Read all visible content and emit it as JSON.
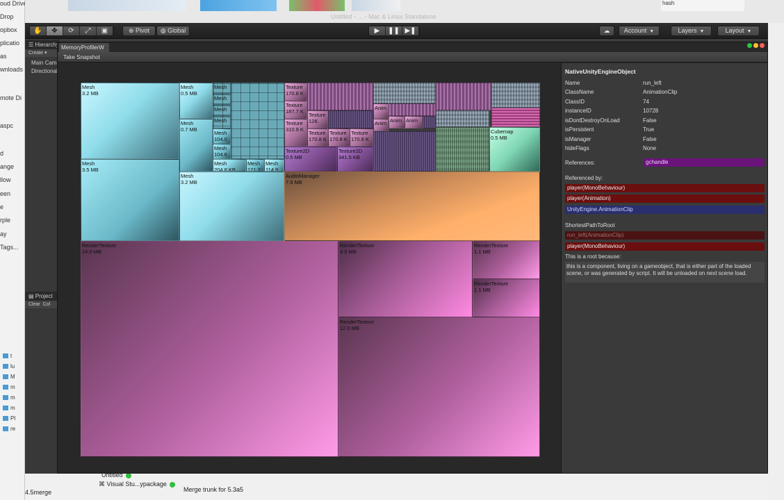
{
  "desktop": {
    "left_items": [
      "oud Drive",
      "Drop",
      "opbox",
      "plicatio",
      "as",
      "wnloads",
      "mote Di",
      "aspc",
      "d",
      "ange",
      "llow",
      "een",
      "e",
      "rple",
      "ay",
      "Tags..."
    ],
    "left_bottom_items": [
      "t",
      "lu",
      "M",
      "m",
      "m",
      "m",
      "Pl",
      "re"
    ],
    "top_hint": "Untitled - ... - Mac & Linux Standalone",
    "bottom_rows": [
      "Untitled",
      "Visual Stu...ypackage",
      "4.5merge",
      "Merge trunk for 5.3a5"
    ],
    "right_labels": [
      "hash"
    ]
  },
  "unity": {
    "toolbar": {
      "tools": [
        "✋",
        "✥",
        "⟳",
        "⤢",
        "▣"
      ],
      "pivot_label": "Pivot",
      "global_label": "Global",
      "play_controls": [
        "▶",
        "❚❚",
        "▶❚"
      ],
      "cloud_icon": "☁",
      "account_label": "Account",
      "layers_label": "Layers",
      "layout_label": "Layout"
    },
    "hierarchy": {
      "tab_label": "Hierarchy",
      "create_label": "Create ▾",
      "items": [
        "Main Camera",
        "Directional Light"
      ]
    },
    "project": {
      "tab_label": "Project",
      "clear_label": "Clear",
      "collapse_label": "Col"
    },
    "memory_profiler": {
      "tab_label": "MemoryProfilerW",
      "take_snapshot_label": "Take Snapshot",
      "treemap": [
        {
          "name": "Mesh",
          "size": "3.2 MB",
          "cls": "cyan"
        },
        {
          "name": "Mesh",
          "size": "3.5 MB",
          "cls": "cyan2"
        },
        {
          "name": "Mesh",
          "size": "0.5 MB",
          "cls": "cyan"
        },
        {
          "name": "Mesh",
          "size": "0.7 MB",
          "cls": "cyan2"
        },
        {
          "name": "Mesh",
          "size": "3.2 MB",
          "cls": "cyan"
        },
        {
          "name": "Mesh",
          "size": "",
          "cls": "small-grid"
        },
        {
          "name": "Mesh",
          "size": "",
          "cls": "small-grid"
        },
        {
          "name": "Mesh",
          "size": "",
          "cls": "small-grid"
        },
        {
          "name": "Mesh",
          "size": "",
          "cls": "small-grid"
        },
        {
          "name": "Mesh",
          "size": "104.0",
          "cls": "cyan2"
        },
        {
          "name": "Mesh",
          "size": "104.6",
          "cls": "cyan2"
        },
        {
          "name": "Mesh",
          "size": "204.8 KB",
          "cls": "cyan"
        },
        {
          "name": "Mesh",
          "size": "121.2",
          "cls": "cyan2"
        },
        {
          "name": "Mesh",
          "size": "114.9",
          "cls": "cyan"
        },
        {
          "name": "Texture",
          "size": "170.8 K",
          "cls": "mauve"
        },
        {
          "name": "Texture",
          "size": "187.7 K",
          "cls": "mauve"
        },
        {
          "name": "Texture",
          "size": "310.9 K",
          "cls": "mauve"
        },
        {
          "name": "Texture2D",
          "size": "0.5 MB",
          "cls": "purple"
        },
        {
          "name": "Texture2D",
          "size": "341.5 KB",
          "cls": "purple"
        },
        {
          "name": "Texture",
          "size": "170.8 K",
          "cls": "mauve"
        },
        {
          "name": "Texture",
          "size": "170.8 K",
          "cls": "mauve"
        },
        {
          "name": "Texture",
          "size": "170.8 K",
          "cls": "mauve"
        },
        {
          "name": "Texture",
          "size": "128.",
          "cls": "mauve"
        },
        {
          "name": "Anim",
          "size": "",
          "cls": "mauve"
        },
        {
          "name": "Anim",
          "size": "",
          "cls": "mauve"
        },
        {
          "name": "Anim",
          "size": "",
          "cls": "mauve"
        },
        {
          "name": "Anim",
          "size": "",
          "cls": "mauve"
        },
        {
          "name": "Cubemap",
          "size": "0.5 MB",
          "cls": "greenish"
        },
        {
          "name": "AudioManager",
          "size": "7.9 MB",
          "cls": "orange"
        },
        {
          "name": "RenderTexture",
          "size": "24.0 MB",
          "cls": "pink"
        },
        {
          "name": "RenderTexture",
          "size": "4.5 MB",
          "cls": "pink2"
        },
        {
          "name": "RenderTexture",
          "size": "1.1 MB",
          "cls": "pink"
        },
        {
          "name": "RenderTexture",
          "size": "1.1 MB",
          "cls": "pink2"
        },
        {
          "name": "RenderTexture",
          "size": "12.0 MB",
          "cls": "pink"
        }
      ],
      "inspector": {
        "title": "NativeUnityEngineObject",
        "properties": [
          {
            "key": "Name",
            "value": "run_left"
          },
          {
            "key": "ClassName",
            "value": "AnimationClip"
          },
          {
            "key": "ClassID",
            "value": "74"
          },
          {
            "key": "instanceID",
            "value": "10728"
          },
          {
            "key": "isDontDestroyOnLoad",
            "value": "False"
          },
          {
            "key": "isPersistent",
            "value": "True"
          },
          {
            "key": "isManager",
            "value": "False"
          },
          {
            "key": "hideFlags",
            "value": "None"
          }
        ],
        "references_label": "References:",
        "references": [
          "gchandle"
        ],
        "referenced_by_label": "Referenced by:",
        "referenced_by": [
          {
            "label": "player(MonoBehaviour)",
            "kind": "red"
          },
          {
            "label": "player(Animation)",
            "kind": "red"
          },
          {
            "label": "UnityEngine.AnimationClip",
            "kind": "blue"
          }
        ],
        "shortest_path_label": "ShortestPathToRoot",
        "shortest_path": [
          {
            "label": "run_left(AnimationClip)",
            "kind": "red dim"
          },
          {
            "label": "player(MonoBehaviour)",
            "kind": "red"
          }
        ],
        "root_reason_label": "This is a root because:",
        "root_reason": "this is a component, living on a gameobject, that is either part of the loaded scene, or was generated by script. It will be unloaded on next scene load."
      }
    }
  },
  "colors": {
    "reference_red": "#6b0e0e",
    "reference_blue": "#2a2e6e",
    "gchandle_purple": "#6a137a",
    "close_red": "#ff5f57",
    "minimize_yellow": "#ffbd2e",
    "zoom_green": "#28c840"
  }
}
